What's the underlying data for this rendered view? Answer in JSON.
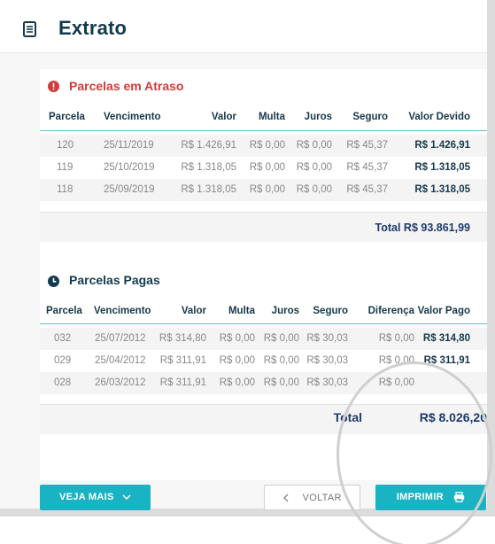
{
  "page": {
    "title": "Extrato",
    "icon": "document-list-icon"
  },
  "colors": {
    "title": "#123a50",
    "accent": "#1ab3c4",
    "overdue": "#d33a3a",
    "paid": "#123a50",
    "total": "#1d3a6a"
  },
  "overdue": {
    "title": "Parcelas em Atraso",
    "icon": "alert-icon",
    "columns": [
      "Parcela",
      "Vencimento",
      "Valor",
      "Multa",
      "Juros",
      "Seguro",
      "Valor Devido"
    ],
    "rows": [
      [
        "120",
        "25/11/2019",
        "R$ 1.426,91",
        "R$ 0,00",
        "R$ 0,00",
        "R$ 45,37",
        "R$ 1.426,91"
      ],
      [
        "119",
        "25/10/2019",
        "R$ 1.318,05",
        "R$ 0,00",
        "R$ 0,00",
        "R$ 45,37",
        "R$ 1.318,05"
      ],
      [
        "118",
        "25/09/2019",
        "R$ 1.318,05",
        "R$ 0,00",
        "R$ 0,00",
        "R$ 45,37",
        "R$ 1.318,05"
      ]
    ],
    "total": "Total R$ 93.861,99"
  },
  "paid": {
    "title": "Parcelas Pagas",
    "icon": "clock-icon",
    "columns": [
      "Parcela",
      "Vencimento",
      "Valor",
      "Multa",
      "Juros",
      "Seguro",
      "Diferença",
      "Valor Pago"
    ],
    "rows": [
      [
        "032",
        "25/07/2012",
        "R$ 314,80",
        "R$ 0,00",
        "R$ 0,00",
        "R$ 30,03",
        "R$ 0,00",
        "R$ 314,80"
      ],
      [
        "029",
        "25/04/2012",
        "R$ 311,91",
        "R$ 0,00",
        "R$ 0,00",
        "R$ 30,03",
        "R$ 0,00",
        "R$ 311,91"
      ],
      [
        "028",
        "26/03/2012",
        "R$ 311,91",
        "R$ 0,00",
        "R$ 0,00",
        "R$ 30,03",
        "R$ 0,00",
        ""
      ]
    ],
    "total_label": "Total",
    "total_value": "R$ 8.026,20"
  },
  "buttons": {
    "more": "VEJA MAIS",
    "back": "VOLTAR",
    "print": "IMPRIMIR"
  }
}
